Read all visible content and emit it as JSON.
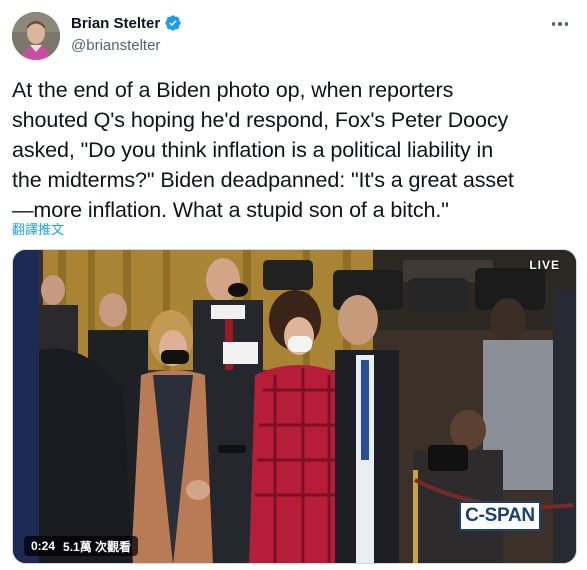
{
  "author": {
    "name": "Brian Stelter",
    "handle": "@brianstelter",
    "verified": true
  },
  "tweet": {
    "text_lines": [
      "At the end of a Biden photo op, when reporters",
      "shouted Q's hoping he'd respond, Fox's Peter Doocy",
      "asked, \"Do you think inflation is a political liability in",
      "the midterms?\" Biden deadpanned: \"It's a great asset",
      "—more inflation. What a stupid son of a bitch.\""
    ],
    "translate_label": "翻譯推文"
  },
  "media": {
    "live_label": "LIVE",
    "logo_text": "C-SPAN",
    "timestamp": "0:24",
    "views": "5.1萬 次觀看"
  },
  "colors": {
    "verified_blue": "#1d9bf0",
    "link_blue": "#1d9bf0",
    "secondary_text": "#536471",
    "cspan_blue": "#1a3e7a"
  },
  "icons": {
    "verified": "verified-badge-icon",
    "more": "more-dots-icon"
  }
}
